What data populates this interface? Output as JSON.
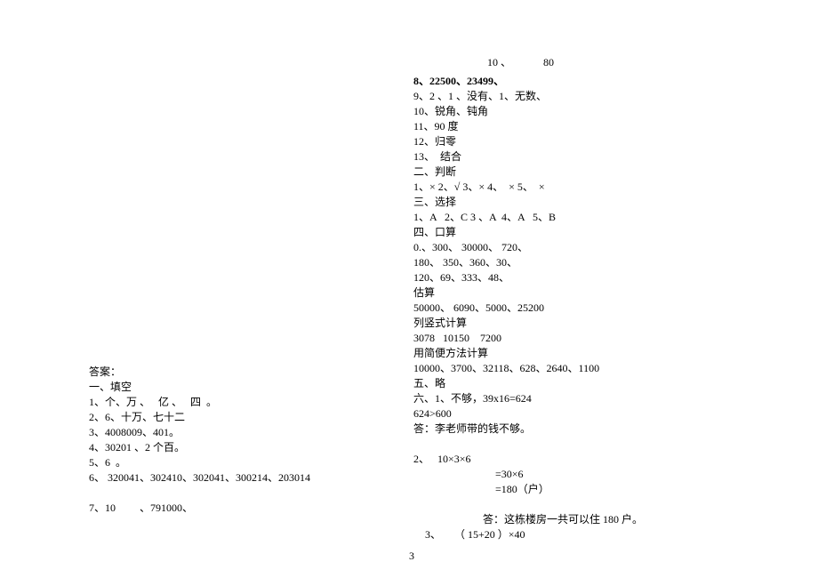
{
  "top": {
    "line": "10 、            80"
  },
  "right": {
    "l01": "8、22500、23499、",
    "l02": "9、2 、1 、没有、1、无数、",
    "l03": "10、锐角、钝角",
    "l04": "11、90 度",
    "l05": "12、归零",
    "l06": "13、  结合",
    "l07": "二、判断",
    "l08": "1、× 2、√ 3、× 4、  × 5、  ×",
    "l09": "三、选择",
    "l10": "1、A   2、C 3 、A  4、A   5、B",
    "l11": "四、口算",
    "l12": "0.、300、 30000、 720、",
    "l13": "180、 350、360、30、",
    "l14": "120、69、333、48、",
    "l15": "估算",
    "l16": "50000、 6090、5000、25200",
    "l17": "列竖式计算",
    "l18": "3078   10150    7200",
    "l19": "用简便方法计算",
    "l20": "10000、3700、32118、628、2640、1100",
    "l21": "五、略",
    "l22": "六、1、不够，39x16=624",
    "l23": "624>600",
    "l24": "答：李老师带的钱不够。",
    "l25": " ",
    "l26": "2、   10×3×6",
    "l27": "=30×6",
    "l28": "=180（户）",
    "l29": " ",
    "l30": "答：这栋楼房一共可以住 180 户。",
    "l31": " 3、     （ 15+20 ）×40"
  },
  "left": {
    "l01": "答案：",
    "l02": "一、填空",
    "l03": "1、个、万 、   亿 、   四  。",
    "l04": "2、6、十万、七十二",
    "l05": "3、4008009、401。",
    "l06": "4、30201 、2 个百。",
    "l07": "5、6  。",
    "l08": "6、 320041、302410、302041、300214、203014",
    "l09": " ",
    "l10": "7、10         、791000、"
  },
  "footer": {
    "page": "3"
  }
}
